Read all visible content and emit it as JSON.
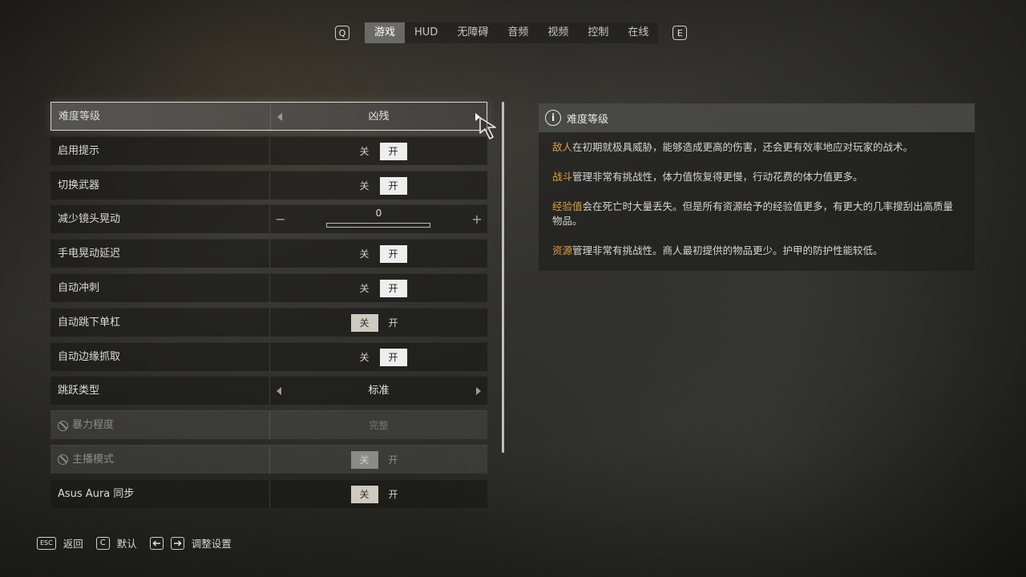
{
  "tabbar": {
    "prev_key": "Q",
    "next_key": "E",
    "tabs": [
      {
        "label": "游戏",
        "active": true
      },
      {
        "label": "HUD"
      },
      {
        "label": "无障碍"
      },
      {
        "label": "音频"
      },
      {
        "label": "视频"
      },
      {
        "label": "控制"
      },
      {
        "label": "在线"
      }
    ]
  },
  "settings": {
    "difficulty": {
      "label": "难度等级",
      "value": "凶残"
    },
    "hints": {
      "label": "启用提示",
      "off": "关",
      "on": "开",
      "state": "on"
    },
    "switch_weapon": {
      "label": "切换武器",
      "off": "关",
      "on": "开",
      "state": "on"
    },
    "camera_bob": {
      "label": "减少镜头晃动",
      "value": "0",
      "fill": 0,
      "minus": "−",
      "plus": "+"
    },
    "flashlight_sway": {
      "label": "手电晃动延迟",
      "off": "关",
      "on": "开",
      "state": "on"
    },
    "auto_sprint": {
      "label": "自动冲刺",
      "off": "关",
      "on": "开",
      "state": "on"
    },
    "auto_drop_bar": {
      "label": "自动跳下单杠",
      "off": "关",
      "on": "开",
      "state": "off"
    },
    "auto_ledge_grab": {
      "label": "自动边缘抓取",
      "off": "关",
      "on": "开",
      "state": "on"
    },
    "jump_type": {
      "label": "跳跃类型",
      "value": "标准"
    },
    "violence": {
      "label": "暴力程度",
      "value": "完整",
      "disabled": true
    },
    "streamer_mode": {
      "label": "主播模式",
      "off": "关",
      "on": "开",
      "state": "off",
      "disabled": true
    },
    "asus_aura": {
      "label": "Asus Aura 同步",
      "off": "关",
      "on": "开",
      "state": "off"
    }
  },
  "info": {
    "title": "难度等级",
    "paragraphs": [
      {
        "highlight": "敌人",
        "text": "在初期就极具威胁，能够造成更高的伤害，还会更有效率地应对玩家的战术。"
      },
      {
        "highlight": "战斗",
        "text": "管理非常有挑战性，体力值恢复得更慢，行动花费的体力值更多。"
      },
      {
        "highlight": "经验值",
        "text": "会在死亡时大量丢失。但是所有资源给予的经验值更多，有更大的几率搜刮出高质量物品。"
      },
      {
        "highlight": "资源",
        "text": "管理非常有挑战性。商人最初提供的物品更少。护甲的防护性能较低。"
      }
    ]
  },
  "footer": {
    "back_key": "ESC",
    "back_label": "返回",
    "default_key": "C",
    "default_label": "默认",
    "adjust_label": "调整设置"
  },
  "colors": {
    "highlight": "#e0a040",
    "toggle_on": "#eeeeee"
  }
}
